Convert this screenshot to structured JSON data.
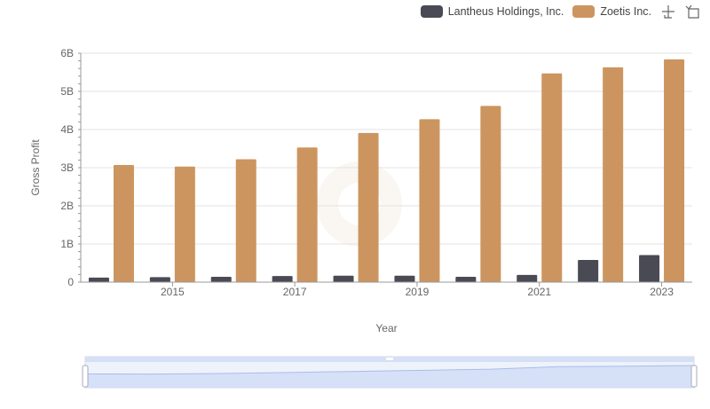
{
  "chart_data": {
    "type": "bar",
    "categories": [
      "2014",
      "2015",
      "2016",
      "2017",
      "2018",
      "2019",
      "2020",
      "2021",
      "2022",
      "2023"
    ],
    "x_tick_labels": [
      "2015",
      "2017",
      "2019",
      "2021",
      "2023"
    ],
    "series": [
      {
        "name": "Lantheus Holdings, Inc.",
        "color": "#4a4a55",
        "values": [
          0.12,
          0.13,
          0.14,
          0.16,
          0.17,
          0.17,
          0.14,
          0.19,
          0.58,
          0.71
        ]
      },
      {
        "name": "Zoetis Inc.",
        "color": "#cc955f",
        "values": [
          3.07,
          3.03,
          3.22,
          3.53,
          3.91,
          4.27,
          4.62,
          5.47,
          5.63,
          5.84
        ]
      }
    ],
    "xlabel": "Year",
    "ylabel": "Gross Profit",
    "y_tick_labels": [
      "0",
      "1B",
      "2B",
      "3B",
      "4B",
      "5B",
      "6B"
    ],
    "ylim": [
      0,
      6
    ],
    "grid": "horizontal",
    "legend_position": "top-right"
  },
  "legend": {
    "items": [
      {
        "label": "Lantheus Holdings, Inc.",
        "color": "#4a4a55"
      },
      {
        "label": "Zoetis Inc.",
        "color": "#cc955f"
      }
    ]
  },
  "toolbar": {
    "icons": [
      "zoom-icon",
      "zoom-reset-icon"
    ]
  },
  "data_zoom": {
    "range_start": 0,
    "range_end": 100,
    "overview_values": [
      3.07,
      3.03,
      3.22,
      3.53,
      3.91,
      4.27,
      4.62,
      5.47,
      5.63,
      5.84
    ]
  }
}
